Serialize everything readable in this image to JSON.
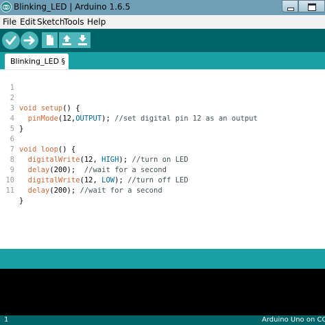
{
  "window": {
    "title": "Blinking_LED | Arduino 1.6.5"
  },
  "menu": [
    "File",
    "Edit",
    "Sketch",
    "Tools",
    "Help"
  ],
  "toolbar": {
    "verify_icon": "checkmark-icon",
    "upload_icon": "arrow-right-icon",
    "new_icon": "new-file-icon",
    "open_icon": "open-arrow-up-icon",
    "save_icon": "save-arrow-down-icon"
  },
  "tab": {
    "label": "Blinking_LED §"
  },
  "code": {
    "lines": [
      {
        "number": "1",
        "text": ""
      },
      {
        "number": "2",
        "text": "void setup() {"
      },
      {
        "number": "3",
        "text": "  pinMode(12,OUTPUT); //set digital pin 12 as an output"
      },
      {
        "number": "4",
        "text": "}"
      },
      {
        "number": "5",
        "text": ""
      },
      {
        "number": "6",
        "text": "void loop() {"
      },
      {
        "number": "7",
        "text": "  digitalWrite(12, HIGH); //turn on LED"
      },
      {
        "number": "8",
        "text": "  delay(200);  //wait for a second"
      },
      {
        "number": "9",
        "text": "  digitalWrite(12, LOW); //turn off LED"
      },
      {
        "number": "10",
        "text": "  delay(200); //wait for a second"
      },
      {
        "number": "11",
        "text": "}"
      }
    ]
  },
  "status": {
    "line_number": "1",
    "board": "Arduino Uno on COM"
  },
  "colors": {
    "toolbar_bg": "#006468",
    "tabstrip_bg": "#17a1a5",
    "button_bg": "#4db7bb",
    "keyword": "#cc6633",
    "constant": "#006699",
    "line_number": "#999999"
  }
}
